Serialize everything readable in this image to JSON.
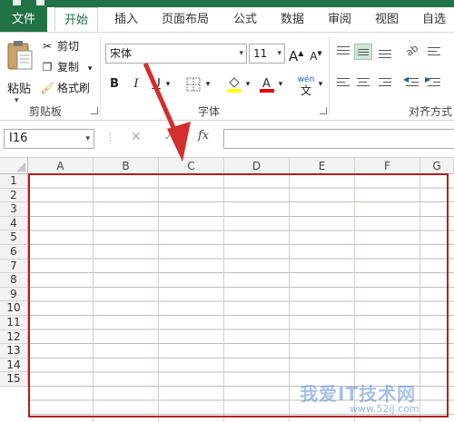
{
  "ribbon_tabs": {
    "file": "文件",
    "home": "开始",
    "insert": "插入",
    "page_layout": "页面布局",
    "formulas": "公式",
    "data": "数据",
    "review": "审阅",
    "view": "视图",
    "auto_sum": "自选"
  },
  "clipboard": {
    "paste": "粘贴",
    "cut": "剪切",
    "copy": "复制",
    "format_painter": "格式刷",
    "group_label": "剪贴板"
  },
  "font": {
    "name": "宋体",
    "size": "11",
    "bold": "B",
    "italic": "I",
    "underline": "U",
    "grow": "A",
    "shrink": "A",
    "phonetic": "wén",
    "group_label": "字体",
    "fill_color": "#ffff00",
    "font_color": "#e00000"
  },
  "alignment": {
    "group_label": "对齐方式",
    "active_color": "#cfe6d4"
  },
  "formula_bar": {
    "name_box": "I16",
    "fx": "fx",
    "cancel": "✕",
    "confirm": "✓",
    "value": ""
  },
  "sheet": {
    "columns": [
      "A",
      "B",
      "C",
      "D",
      "E",
      "F",
      "G"
    ],
    "rows": [
      "1",
      "2",
      "3",
      "4",
      "5",
      "6",
      "7",
      "8",
      "9",
      "10",
      "11",
      "12",
      "13",
      "14",
      "15"
    ],
    "highlight_color": "#b71c1c"
  },
  "watermark": {
    "text": "我爱IT技术网",
    "url": "www.52ij.com"
  },
  "theme": {
    "accent": "#217346",
    "annotation": "#d32f2f"
  }
}
